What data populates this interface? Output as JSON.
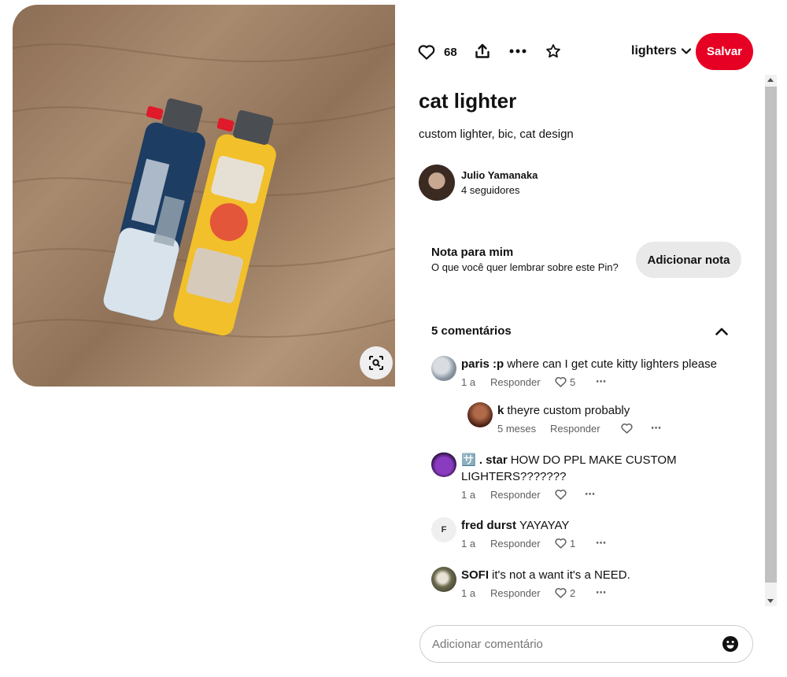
{
  "actions": {
    "like_count": "68",
    "board_name": "lighters",
    "save_label": "Salvar"
  },
  "pin": {
    "title": "cat lighter",
    "description": "custom lighter, bic, cat design"
  },
  "creator": {
    "name": "Julio Yamanaka",
    "followers": "4 seguidores"
  },
  "note": {
    "title": "Nota para mim",
    "subtitle": "O que você quer lembrar sobre este Pin?",
    "button_label": "Adicionar nota"
  },
  "comments_section": {
    "count_label": "5 comentários",
    "reply_label": "Responder",
    "items": [
      {
        "author": "paris :p",
        "text": "where can I get cute kitty lighters please",
        "time": "1 a",
        "likes": "5"
      },
      {
        "author": "k",
        "text": "theyre custom probably",
        "time": "5 meses",
        "likes": ""
      },
      {
        "author": "🈂️ . star",
        "text": "HOW DO PPL MAKE CUSTOM LIGHTERS???????",
        "time": "1 a",
        "likes": ""
      },
      {
        "author": "fred durst",
        "text": "YAYAYAY",
        "time": "1 a",
        "likes": "1",
        "avatar_letter": "F"
      },
      {
        "author": "SOFI",
        "text": "it's not a want it's a NEED.",
        "time": "1 a",
        "likes": "2"
      }
    ]
  },
  "comment_input": {
    "placeholder": "Adicionar comentário"
  },
  "colors": {
    "brand_red": "#e60023",
    "button_gray": "#e9e9e9",
    "meta_gray": "#5f5f5f"
  }
}
